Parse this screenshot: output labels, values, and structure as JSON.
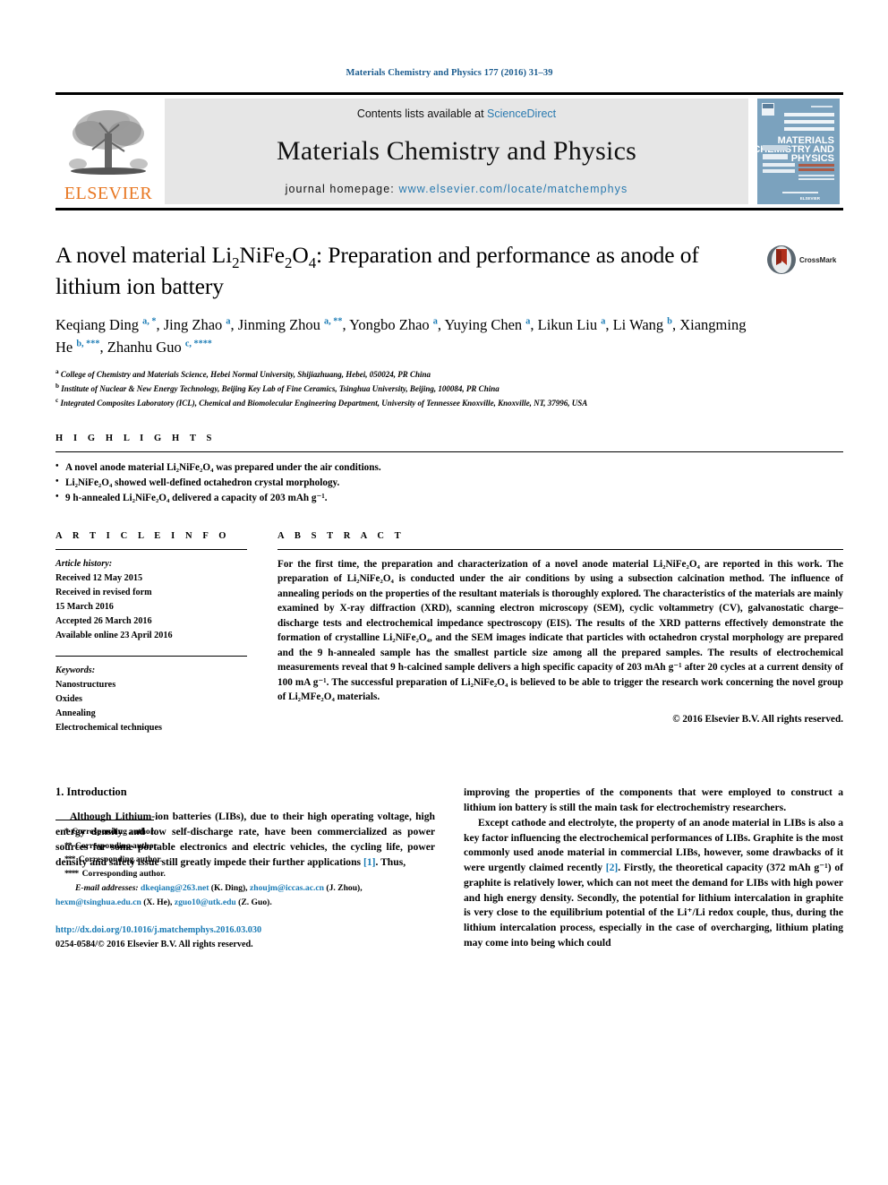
{
  "running_head": "Materials Chemistry and Physics 177 (2016) 31–39",
  "masthead": {
    "publisher_name": "ELSEVIER",
    "contents_prefix": "Contents lists available at ",
    "contents_link": "ScienceDirect",
    "journal_title": "Materials Chemistry and Physics",
    "homepage_prefix": "journal homepage: ",
    "homepage_url": "www.elsevier.com/locate/matchemphys",
    "cover_line1": "MATERIALS",
    "cover_line2": "CHEMISTRY AND",
    "cover_line3": "PHYSICS"
  },
  "article": {
    "title_part1": "A novel material Li",
    "title_sub1": "2",
    "title_part2": "NiFe",
    "title_sub2": "2",
    "title_part3": "O",
    "title_sub3": "4",
    "title_part4": ": Preparation and performance as anode of lithium ion battery",
    "crossmark_label": "CrossMark",
    "authors": [
      {
        "name": "Keqiang Ding",
        "marks": "a, *",
        "sep": ", "
      },
      {
        "name": "Jing Zhao",
        "marks": "a",
        "sep": ", "
      },
      {
        "name": "Jinming Zhou",
        "marks": "a, **",
        "sep": ", "
      },
      {
        "name": "Yongbo Zhao",
        "marks": "a",
        "sep": ", "
      },
      {
        "name": "Yuying Chen",
        "marks": "a",
        "sep": ", "
      },
      {
        "name": "Likun Liu",
        "marks": "a",
        "sep": ", "
      },
      {
        "name": "Li Wang",
        "marks": "b",
        "sep": ", "
      },
      {
        "name": "Xiangming He",
        "marks": "b, ***",
        "sep": ", "
      },
      {
        "name": "Zhanhu Guo",
        "marks": "c, ****",
        "sep": ""
      }
    ],
    "affiliations": [
      {
        "mark": "a",
        "text": "College of Chemistry and Materials Science, Hebei Normal University, Shijiazhuang, Hebei, 050024, PR China"
      },
      {
        "mark": "b",
        "text": "Institute of Nuclear & New Energy Technology, Beijing Key Lab of Fine Ceramics, Tsinghua University, Beijing, 100084, PR China"
      },
      {
        "mark": "c",
        "text": "Integrated Composites Laboratory (ICL), Chemical and Biomolecular Engineering Department, University of Tennessee Knoxville, Knoxville, NT, 37996, USA"
      }
    ]
  },
  "highlights": {
    "heading": "H I G H L I G H T S",
    "items": [
      "A novel anode material Li₂NiFe₂O₄ was prepared under the air conditions.",
      "Li₂NiFe₂O₄ showed well-defined octahedron crystal morphology.",
      "9 h-annealed Li₂NiFe₂O₄ delivered a capacity of 203 mAh g⁻¹."
    ]
  },
  "article_info": {
    "heading": "A R T I C L E   I N F O",
    "history_label": "Article history:",
    "history": [
      "Received 12 May 2015",
      "Received in revised form",
      "15 March 2016",
      "Accepted 26 March 2016",
      "Available online 23 April 2016"
    ],
    "keywords_label": "Keywords:",
    "keywords": [
      "Nanostructures",
      "Oxides",
      "Annealing",
      "Electrochemical techniques"
    ]
  },
  "abstract": {
    "heading": "A B S T R A C T",
    "text": "For the first time, the preparation and characterization of a novel anode material Li₂NiFe₂O₄ are reported in this work. The preparation of Li₂NiFe₂O₄ is conducted under the air conditions by using a subsection calcination method. The influence of annealing periods on the properties of the resultant materials is thoroughly explored. The characteristics of the materials are mainly examined by X-ray diffraction (XRD), scanning electron microscopy (SEM), cyclic voltammetry (CV), galvanostatic charge–discharge tests and electrochemical impedance spectroscopy (EIS). The results of the XRD patterns effectively demonstrate the formation of crystalline Li₂NiFe₂O₄, and the SEM images indicate that particles with octahedron crystal morphology are prepared and the 9 h-annealed sample has the smallest particle size among all the prepared samples. The results of electrochemical measurements reveal that 9 h-calcined sample delivers a high specific capacity of 203 mAh g⁻¹ after 20 cycles at a current density of 100 mA g⁻¹. The successful preparation of Li₂NiFe₂O₄ is believed to be able to trigger the research work concerning the novel group of Li₂MFe₂O₄ materials.",
    "copyright": "© 2016 Elsevier B.V. All rights reserved."
  },
  "body": {
    "section_number_title": "1. Introduction",
    "left_paragraph": "Although Lithium-ion batteries (LIBs), due to their high operating voltage, high energy density and low self-discharge rate, have been commercialized as power sources for some portable electronics and electric vehicles, the cycling life, power density and safety issue still greatly impede their further applications ",
    "left_ref": "[1]",
    "left_paragraph_tail": ". Thus,",
    "right_paragraph_1": "improving the properties of the components that were employed to construct a lithium ion battery is still the main task for electrochemistry researchers.",
    "right_paragraph_2_a": "Except cathode and electrolyte, the property of an anode material in LIBs is also a key factor influencing the electrochemical performances of LIBs. Graphite is the most commonly used anode material in commercial LIBs, however, some drawbacks of it were urgently claimed recently ",
    "right_ref": "[2]",
    "right_paragraph_2_b": ". Firstly, the theoretical capacity (372 mAh g⁻¹) of graphite is relatively lower, which can not meet the demand for LIBs with high power and high energy density. Secondly, the potential for lithium intercalation in graphite is very close to the equilibrium potential of the Li⁺/Li redox couple, thus, during the lithium intercalation process, especially in the case of overcharging, lithium plating may come into being which could"
  },
  "footnotes": {
    "corresponding": [
      {
        "star": "*",
        "text": "Corresponding author."
      },
      {
        "star": "**",
        "text": "Corresponding author."
      },
      {
        "star": "***",
        "text": "Corresponding author."
      },
      {
        "star": "****",
        "text": "Corresponding author."
      }
    ],
    "email_label": "E-mail addresses:",
    "emails": [
      {
        "addr": "dkeqiang@263.net",
        "who": " (K. Ding), "
      },
      {
        "addr": "zhoujm@iccas.ac.cn",
        "who": " (J. Zhou), "
      },
      {
        "addr": "hexm@tsinghua.edu.cn",
        "who": " (X. He), "
      },
      {
        "addr": "zguo10@utk.edu",
        "who": " (Z. Guo)."
      }
    ],
    "doi": "http://dx.doi.org/10.1016/j.matchemphys.2016.03.030",
    "issn_line": "0254-0584/© 2016 Elsevier B.V. All rights reserved."
  },
  "colors": {
    "link_blue": "#1a7bb5",
    "elsevier_orange": "#E87722",
    "masthead_gray": "#e6e6e6",
    "cover_blue": "#7ba2be"
  }
}
